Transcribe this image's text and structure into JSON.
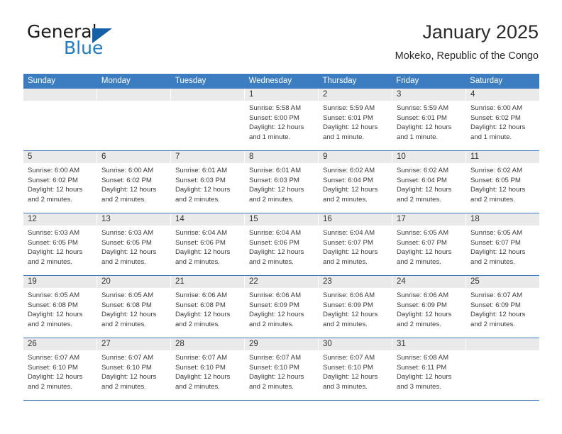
{
  "brand": {
    "name_part1": "General",
    "name_part2": "Blue",
    "triangle_color": "#1461a8",
    "blue_color": "#1f7ac4"
  },
  "header": {
    "title": "January 2025",
    "subtitle": "Mokeko, Republic of the Congo"
  },
  "theme": {
    "header_blue": "#3b7dc0",
    "daynum_band": "#eaeaea",
    "text": "#3a3a3a"
  },
  "weekdays": [
    "Sunday",
    "Monday",
    "Tuesday",
    "Wednesday",
    "Thursday",
    "Friday",
    "Saturday"
  ],
  "weeks": [
    [
      {
        "day": "",
        "lines": []
      },
      {
        "day": "",
        "lines": []
      },
      {
        "day": "",
        "lines": []
      },
      {
        "day": "1",
        "lines": [
          "Sunrise: 5:58 AM",
          "Sunset: 6:00 PM",
          "Daylight: 12 hours",
          "and 1 minute."
        ]
      },
      {
        "day": "2",
        "lines": [
          "Sunrise: 5:59 AM",
          "Sunset: 6:01 PM",
          "Daylight: 12 hours",
          "and 1 minute."
        ]
      },
      {
        "day": "3",
        "lines": [
          "Sunrise: 5:59 AM",
          "Sunset: 6:01 PM",
          "Daylight: 12 hours",
          "and 1 minute."
        ]
      },
      {
        "day": "4",
        "lines": [
          "Sunrise: 6:00 AM",
          "Sunset: 6:02 PM",
          "Daylight: 12 hours",
          "and 1 minute."
        ]
      }
    ],
    [
      {
        "day": "5",
        "lines": [
          "Sunrise: 6:00 AM",
          "Sunset: 6:02 PM",
          "Daylight: 12 hours",
          "and 2 minutes."
        ]
      },
      {
        "day": "6",
        "lines": [
          "Sunrise: 6:00 AM",
          "Sunset: 6:02 PM",
          "Daylight: 12 hours",
          "and 2 minutes."
        ]
      },
      {
        "day": "7",
        "lines": [
          "Sunrise: 6:01 AM",
          "Sunset: 6:03 PM",
          "Daylight: 12 hours",
          "and 2 minutes."
        ]
      },
      {
        "day": "8",
        "lines": [
          "Sunrise: 6:01 AM",
          "Sunset: 6:03 PM",
          "Daylight: 12 hours",
          "and 2 minutes."
        ]
      },
      {
        "day": "9",
        "lines": [
          "Sunrise: 6:02 AM",
          "Sunset: 6:04 PM",
          "Daylight: 12 hours",
          "and 2 minutes."
        ]
      },
      {
        "day": "10",
        "lines": [
          "Sunrise: 6:02 AM",
          "Sunset: 6:04 PM",
          "Daylight: 12 hours",
          "and 2 minutes."
        ]
      },
      {
        "day": "11",
        "lines": [
          "Sunrise: 6:02 AM",
          "Sunset: 6:05 PM",
          "Daylight: 12 hours",
          "and 2 minutes."
        ]
      }
    ],
    [
      {
        "day": "12",
        "lines": [
          "Sunrise: 6:03 AM",
          "Sunset: 6:05 PM",
          "Daylight: 12 hours",
          "and 2 minutes."
        ]
      },
      {
        "day": "13",
        "lines": [
          "Sunrise: 6:03 AM",
          "Sunset: 6:05 PM",
          "Daylight: 12 hours",
          "and 2 minutes."
        ]
      },
      {
        "day": "14",
        "lines": [
          "Sunrise: 6:04 AM",
          "Sunset: 6:06 PM",
          "Daylight: 12 hours",
          "and 2 minutes."
        ]
      },
      {
        "day": "15",
        "lines": [
          "Sunrise: 6:04 AM",
          "Sunset: 6:06 PM",
          "Daylight: 12 hours",
          "and 2 minutes."
        ]
      },
      {
        "day": "16",
        "lines": [
          "Sunrise: 6:04 AM",
          "Sunset: 6:07 PM",
          "Daylight: 12 hours",
          "and 2 minutes."
        ]
      },
      {
        "day": "17",
        "lines": [
          "Sunrise: 6:05 AM",
          "Sunset: 6:07 PM",
          "Daylight: 12 hours",
          "and 2 minutes."
        ]
      },
      {
        "day": "18",
        "lines": [
          "Sunrise: 6:05 AM",
          "Sunset: 6:07 PM",
          "Daylight: 12 hours",
          "and 2 minutes."
        ]
      }
    ],
    [
      {
        "day": "19",
        "lines": [
          "Sunrise: 6:05 AM",
          "Sunset: 6:08 PM",
          "Daylight: 12 hours",
          "and 2 minutes."
        ]
      },
      {
        "day": "20",
        "lines": [
          "Sunrise: 6:05 AM",
          "Sunset: 6:08 PM",
          "Daylight: 12 hours",
          "and 2 minutes."
        ]
      },
      {
        "day": "21",
        "lines": [
          "Sunrise: 6:06 AM",
          "Sunset: 6:08 PM",
          "Daylight: 12 hours",
          "and 2 minutes."
        ]
      },
      {
        "day": "22",
        "lines": [
          "Sunrise: 6:06 AM",
          "Sunset: 6:09 PM",
          "Daylight: 12 hours",
          "and 2 minutes."
        ]
      },
      {
        "day": "23",
        "lines": [
          "Sunrise: 6:06 AM",
          "Sunset: 6:09 PM",
          "Daylight: 12 hours",
          "and 2 minutes."
        ]
      },
      {
        "day": "24",
        "lines": [
          "Sunrise: 6:06 AM",
          "Sunset: 6:09 PM",
          "Daylight: 12 hours",
          "and 2 minutes."
        ]
      },
      {
        "day": "25",
        "lines": [
          "Sunrise: 6:07 AM",
          "Sunset: 6:09 PM",
          "Daylight: 12 hours",
          "and 2 minutes."
        ]
      }
    ],
    [
      {
        "day": "26",
        "lines": [
          "Sunrise: 6:07 AM",
          "Sunset: 6:10 PM",
          "Daylight: 12 hours",
          "and 2 minutes."
        ]
      },
      {
        "day": "27",
        "lines": [
          "Sunrise: 6:07 AM",
          "Sunset: 6:10 PM",
          "Daylight: 12 hours",
          "and 2 minutes."
        ]
      },
      {
        "day": "28",
        "lines": [
          "Sunrise: 6:07 AM",
          "Sunset: 6:10 PM",
          "Daylight: 12 hours",
          "and 2 minutes."
        ]
      },
      {
        "day": "29",
        "lines": [
          "Sunrise: 6:07 AM",
          "Sunset: 6:10 PM",
          "Daylight: 12 hours",
          "and 2 minutes."
        ]
      },
      {
        "day": "30",
        "lines": [
          "Sunrise: 6:07 AM",
          "Sunset: 6:10 PM",
          "Daylight: 12 hours",
          "and 3 minutes."
        ]
      },
      {
        "day": "31",
        "lines": [
          "Sunrise: 6:08 AM",
          "Sunset: 6:11 PM",
          "Daylight: 12 hours",
          "and 3 minutes."
        ]
      },
      {
        "day": "",
        "lines": []
      }
    ]
  ]
}
